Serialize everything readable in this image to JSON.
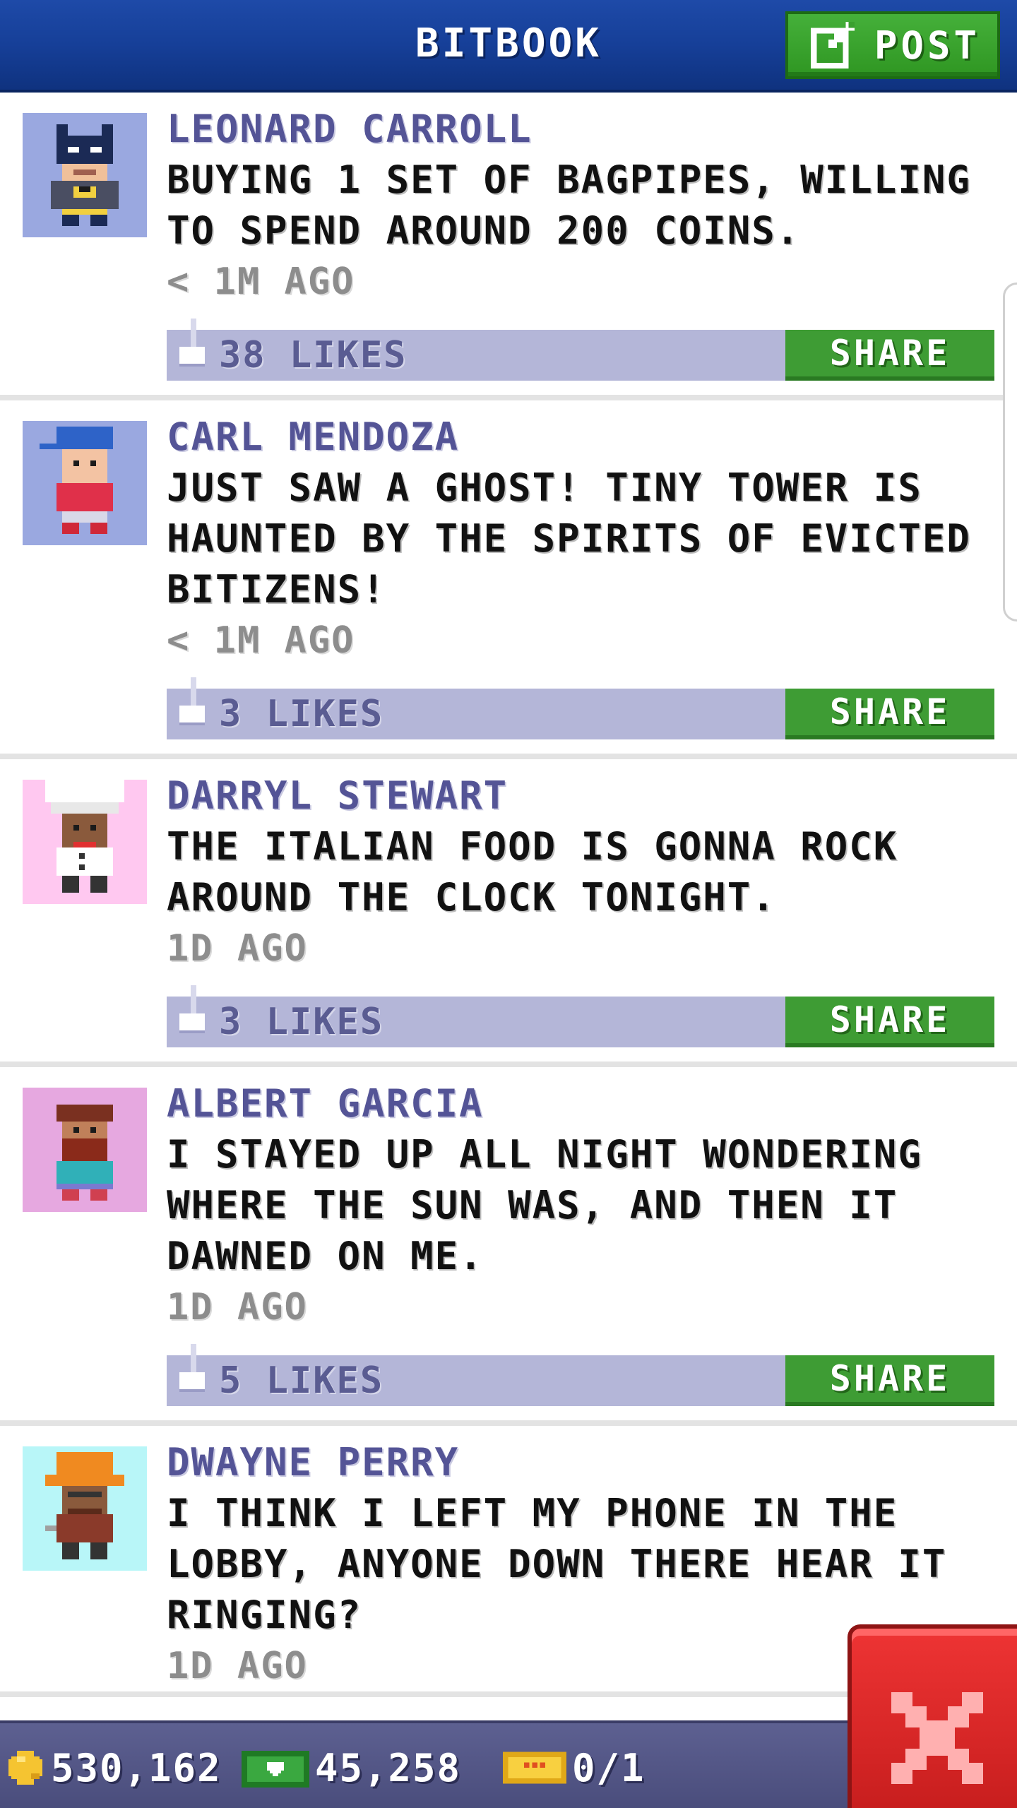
{
  "header": {
    "title": "BITBOOK",
    "post_label": "POST",
    "post_icon": "edit-square-icon"
  },
  "posts": [
    {
      "author": "LEONARD CARROLL",
      "message": "BUYING 1 SET OF BAGPIPES, WILLING TO SPEND AROUND 200 COINS.",
      "time": "< 1M AGO",
      "likes": "38 LIKES",
      "share_label": "SHARE",
      "avatar_bg": "#9aa8e0",
      "avatar": "batman-avatar-icon"
    },
    {
      "author": "CARL MENDOZA",
      "message": "JUST SAW A GHOST! TINY TOWER IS HAUNTED BY THE SPIRITS OF EVICTED BITIZENS!",
      "time": "< 1M AGO",
      "likes": "3 LIKES",
      "share_label": "SHARE",
      "avatar_bg": "#9aa8e0",
      "avatar": "blue-cap-avatar-icon"
    },
    {
      "author": "DARRYL STEWART",
      "message": "THE ITALIAN FOOD IS GONNA ROCK AROUND THE CLOCK TONIGHT.",
      "time": "1D AGO",
      "likes": "3 LIKES",
      "share_label": "SHARE",
      "avatar_bg": "#ffc8f0",
      "avatar": "chef-avatar-icon"
    },
    {
      "author": "ALBERT GARCIA",
      "message": "I STAYED UP ALL NIGHT WONDERING WHERE THE SUN WAS, AND THEN IT DAWNED ON ME.",
      "time": "1D AGO",
      "likes": "5 LIKES",
      "share_label": "SHARE",
      "avatar_bg": "#e6a8e0",
      "avatar": "bearded-avatar-icon"
    },
    {
      "author": "DWAYNE PERRY",
      "message": "I THINK I LEFT MY PHONE IN THE LOBBY, ANYONE DOWN THERE HEAR IT RINGING?",
      "time": "1D AGO",
      "likes": "",
      "share_label": "",
      "avatar_bg": "#b8f6f8",
      "avatar": "hard-hat-avatar-icon"
    }
  ],
  "status_bar": {
    "coins": "530,162",
    "bux": "45,258",
    "tickets": "0/1",
    "coin_icon": "gold-coin-icon",
    "bux_icon": "green-bux-icon",
    "ticket_icon": "golden-ticket-icon"
  },
  "close_icon": "close-x-icon",
  "colors": {
    "header_blue": "#163f98",
    "author_purple": "#545496",
    "action_bar": "#b4b6d8",
    "share_green": "#3e9c34",
    "close_red": "#d42828"
  }
}
